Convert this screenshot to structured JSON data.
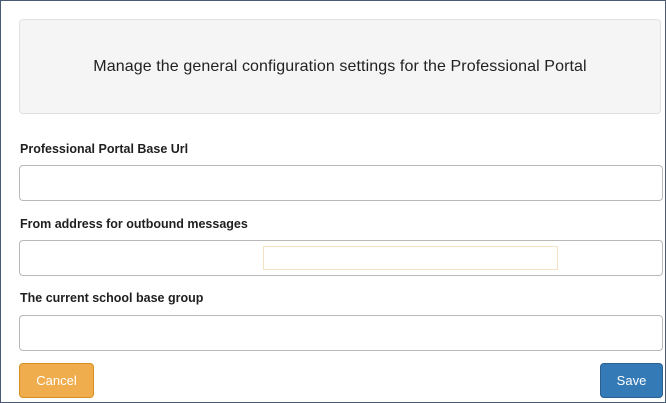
{
  "header": {
    "description": "Manage the general configuration settings for the Professional Portal"
  },
  "fields": [
    {
      "label": "Professional Portal Base Url",
      "value": "",
      "placeholder": ""
    },
    {
      "label": "From address for outbound messages",
      "value": "",
      "placeholder": ""
    },
    {
      "label": "The current school base group",
      "value": "",
      "placeholder": ""
    }
  ],
  "actions": {
    "cancel_label": "Cancel",
    "save_label": "Save"
  },
  "colors": {
    "cancel": "#f0ad4e",
    "save": "#337ab7",
    "panel": "#f5f5f5"
  }
}
